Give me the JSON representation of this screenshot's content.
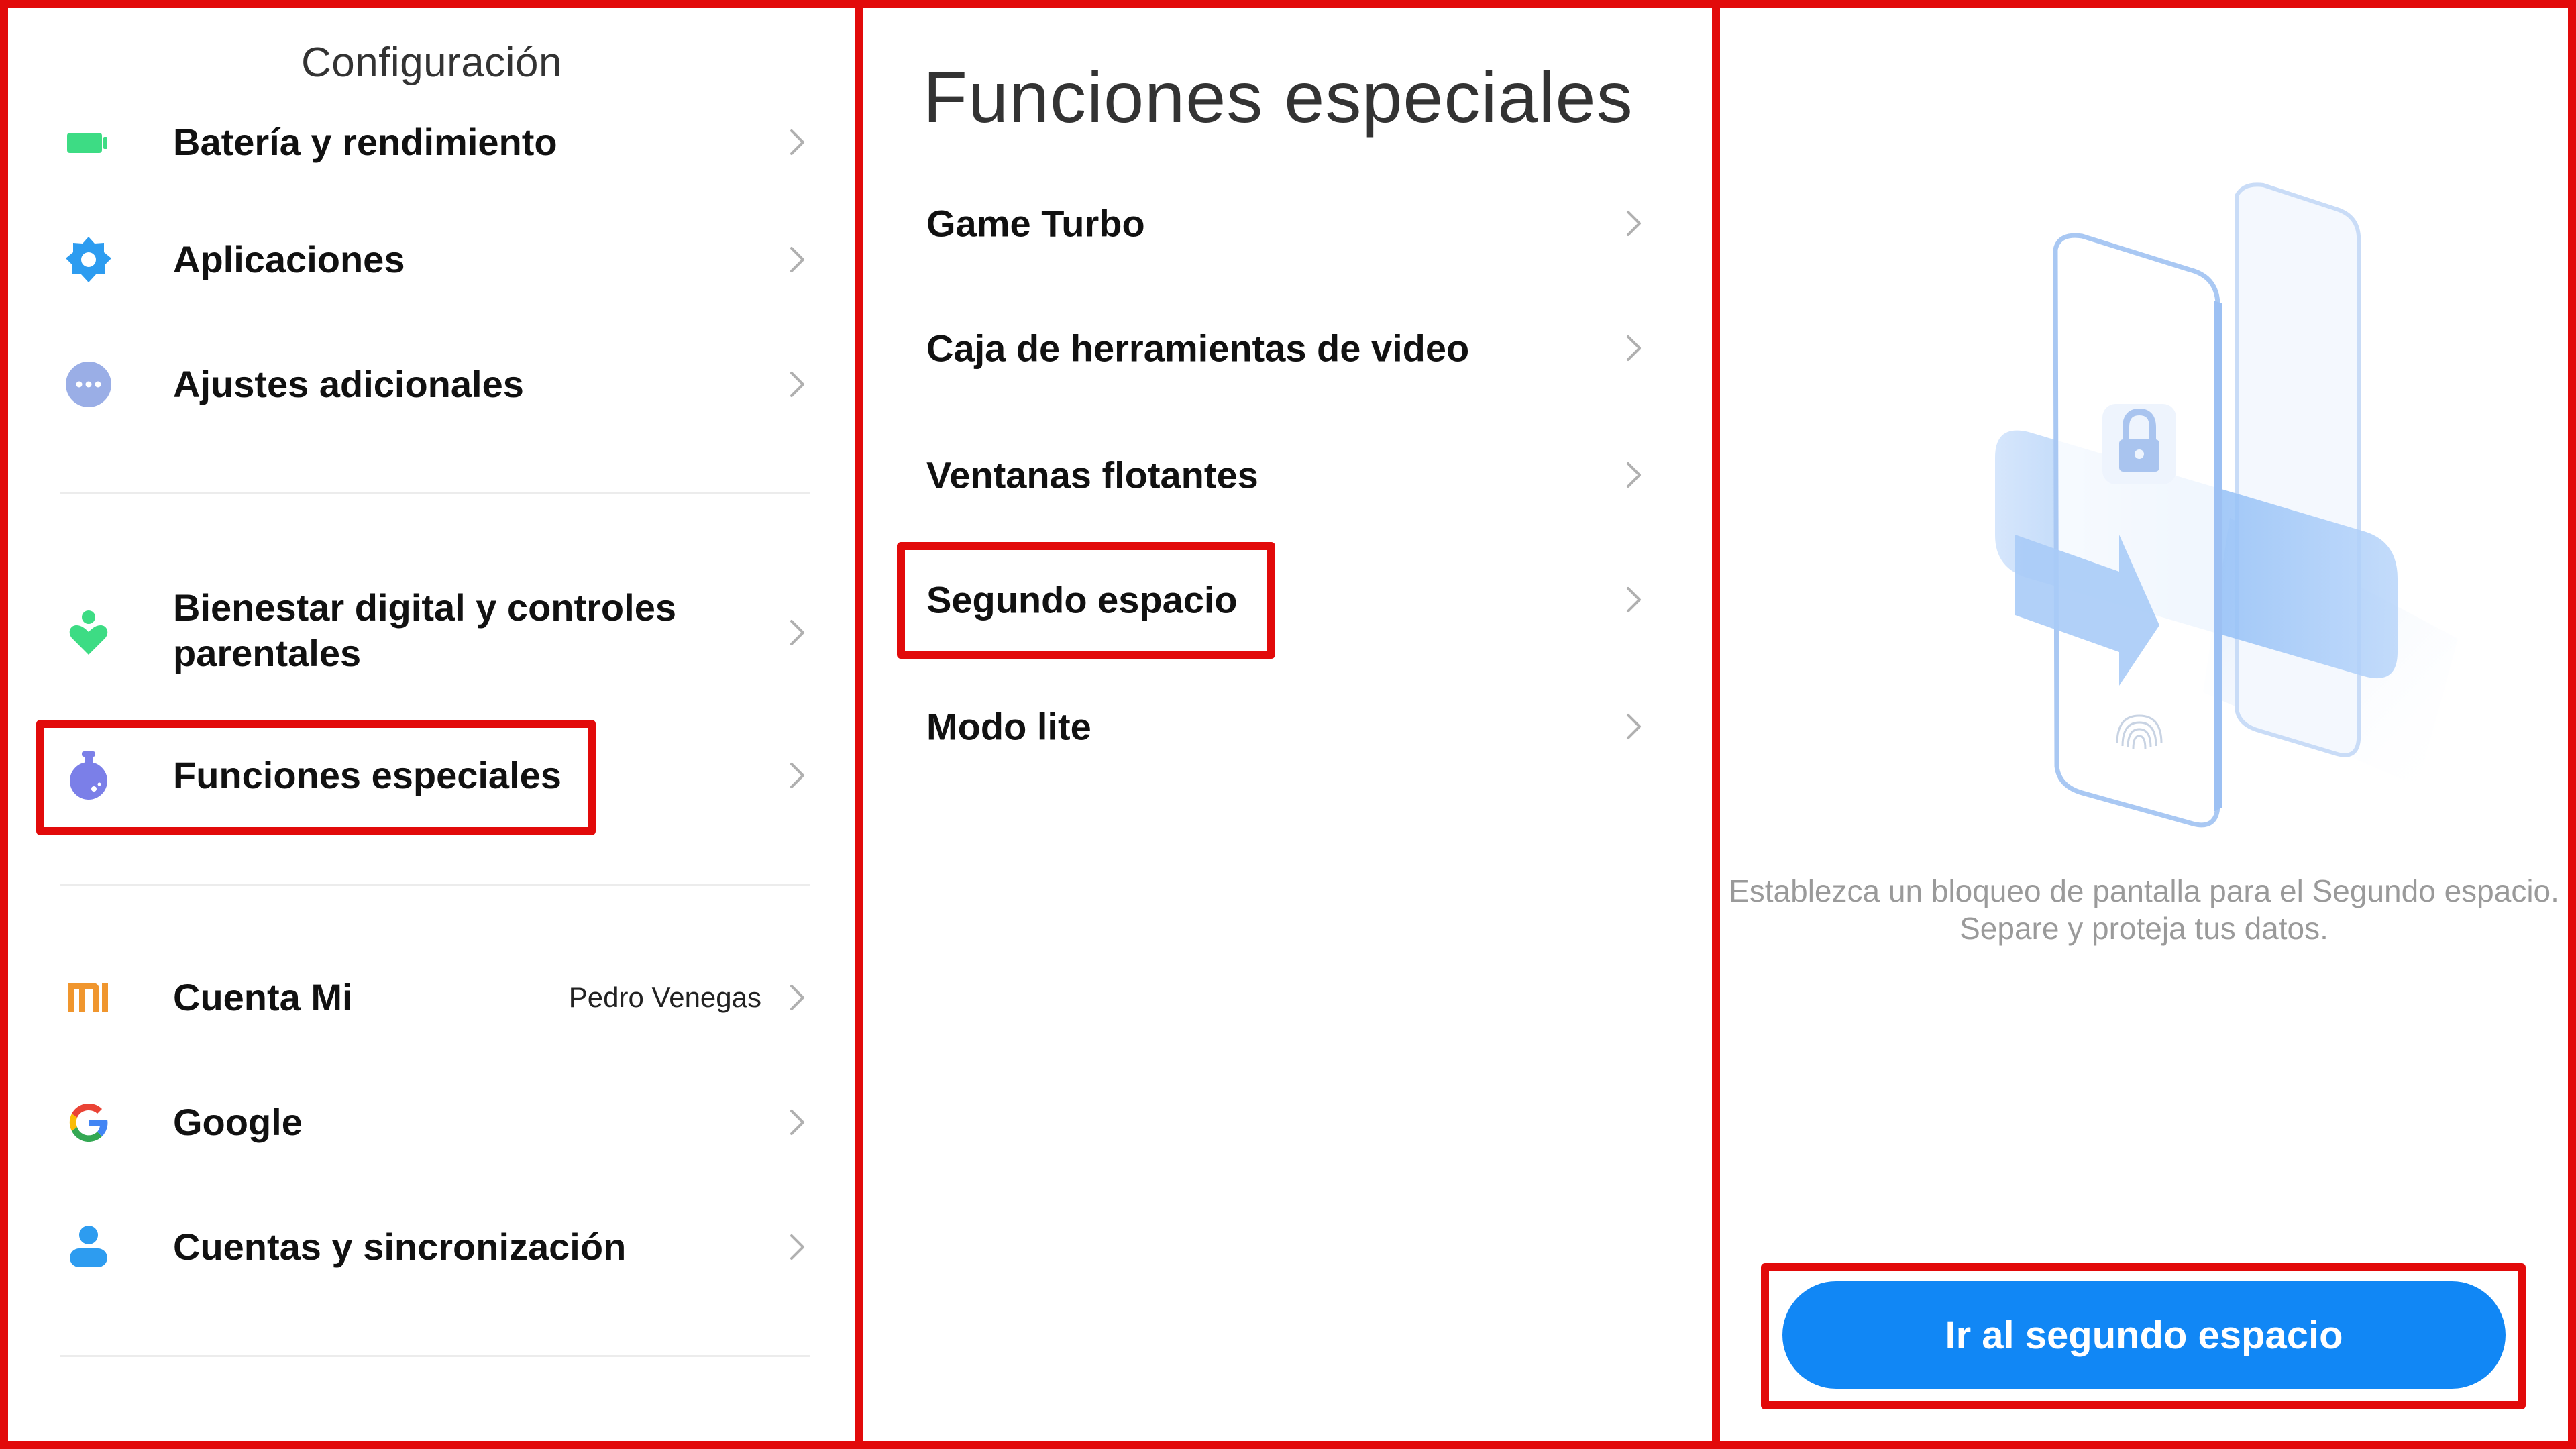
{
  "settings_panel": {
    "title": "Configuración",
    "groups": [
      [
        {
          "label": "Batería y rendimiento",
          "icon": "battery-icon",
          "color": "#3ddc84"
        },
        {
          "label": "Aplicaciones",
          "icon": "gear-icon",
          "color": "#2d9cf0"
        },
        {
          "label": "Ajustes adicionales",
          "icon": "more-dots-icon",
          "color": "#9aaee6"
        }
      ],
      [
        {
          "label": "Bienestar digital y controles parentales",
          "label_line1": "Bienestar digital y controles",
          "label_line2": "parentales",
          "icon": "digital-wellbeing-icon",
          "color": "#3ddc84"
        },
        {
          "label": "Funciones especiales",
          "icon": "flask-icon",
          "color": "#7b7fe8",
          "highlighted": true
        }
      ],
      [
        {
          "label": "Cuenta Mi",
          "value": "Pedro Venegas",
          "icon": "mi-logo-icon",
          "color": "#f0962e"
        },
        {
          "label": "Google",
          "icon": "google-icon"
        },
        {
          "label": "Cuentas y sincronización",
          "icon": "person-icon",
          "color": "#2d9cf0"
        }
      ]
    ]
  },
  "special_panel": {
    "title": "Funciones especiales",
    "items": [
      {
        "label": "Game Turbo"
      },
      {
        "label": "Caja de herramientas de video"
      },
      {
        "label": "Ventanas flotantes"
      },
      {
        "label": "Segundo espacio",
        "highlighted": true
      },
      {
        "label": "Modo lite"
      }
    ]
  },
  "second_space_panel": {
    "illustration": "second-space-illustration",
    "caption_line1": "Establezca un bloqueo de pantalla para el Segundo espacio.",
    "caption_line2": "Separe y proteja tus datos.",
    "button_label": "Ir al segundo espacio",
    "button_color": "#1187f5"
  },
  "colors": {
    "highlight": "#e20a0a",
    "chevron": "#b0b0b0"
  }
}
